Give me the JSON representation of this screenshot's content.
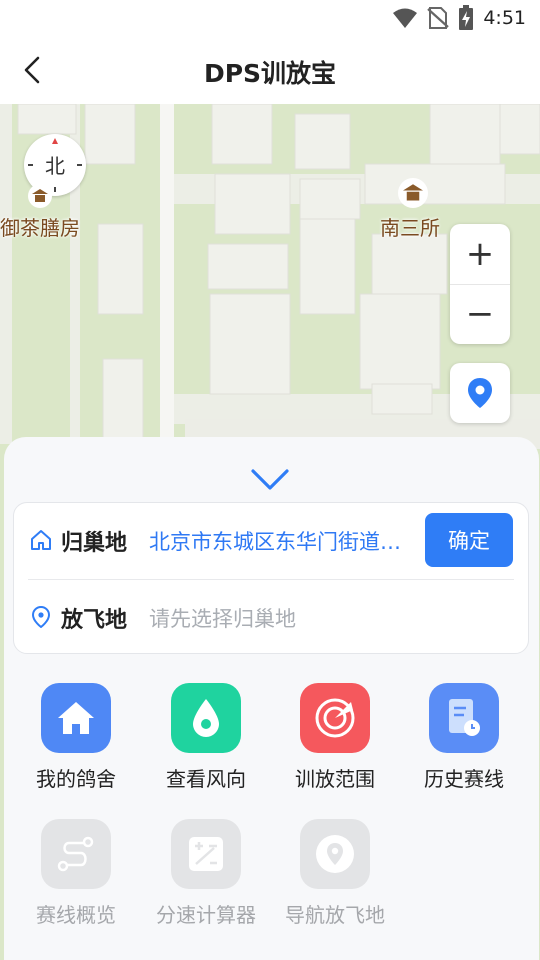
{
  "status_bar": {
    "time": "4:51",
    "icons": [
      "wifi-icon",
      "no-sim-icon",
      "battery-charging-icon"
    ]
  },
  "header": {
    "title": "DPS训放宝",
    "back_icon": "chevron-left-icon"
  },
  "map": {
    "compass_label": "北",
    "pois": [
      {
        "label": "御茶膳房",
        "icon": "pavilion-icon"
      },
      {
        "label": "南三所",
        "icon": "pavilion-icon"
      }
    ],
    "zoom_in": "+",
    "zoom_out": "−",
    "colors": {
      "block": "#f0f1eb",
      "green": "#dbe7c8",
      "road": "#f6f6f3"
    }
  },
  "panel": {
    "collapse_icon": "chevron-down-icon",
    "home": {
      "icon": "home-icon",
      "label": "归巢地",
      "value": "北京市东城区东华门街道故宫博物院",
      "confirm": "确定"
    },
    "release": {
      "icon": "location-pin-icon",
      "label": "放飞地",
      "placeholder": "请先选择归巢地"
    },
    "tools": [
      {
        "label": "我的鸽舍",
        "icon": "house-icon",
        "color": "#4f88f5",
        "enabled": true
      },
      {
        "label": "查看风向",
        "icon": "wind-drop-icon",
        "color": "#1fd39f",
        "enabled": true
      },
      {
        "label": "训放范围",
        "icon": "radar-icon",
        "color": "#f5585d",
        "enabled": true
      },
      {
        "label": "历史赛线",
        "icon": "document-clock-icon",
        "color": "#5a8df6",
        "enabled": true
      },
      {
        "label": "赛线概览",
        "icon": "route-icon",
        "color": "#e3e4e6",
        "enabled": false
      },
      {
        "label": "分速计算器",
        "icon": "calculator-icon",
        "color": "#e3e4e6",
        "enabled": false
      },
      {
        "label": "导航放飞地",
        "icon": "navigation-pin-icon",
        "color": "#e3e4e6",
        "enabled": false
      }
    ]
  },
  "colors": {
    "accent": "#2f7df6",
    "link": "#2f79f4"
  }
}
